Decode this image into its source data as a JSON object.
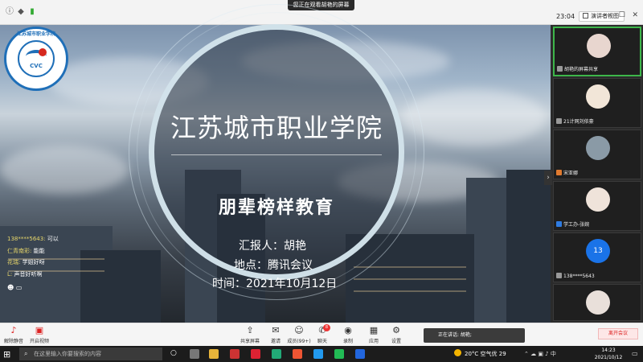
{
  "topbar": {
    "banner": "您正在观看胡艳的屏幕",
    "clock": "23:04",
    "view_mode": "演讲者视图"
  },
  "slide": {
    "school": "江苏城市职业学院",
    "subtitle": "朋辈榜样教育",
    "reporter": "汇报人：胡艳",
    "location": "地点：腾讯会议",
    "time": "时间：2021年10月12日",
    "logo": {
      "ring_text": "江苏城市职业学院",
      "abbr": "CVC"
    }
  },
  "chat": [
    {
      "name": "138****5643:",
      "text": "可以"
    },
    {
      "name": "仁青南彩:",
      "text": "能能"
    },
    {
      "name": "花瑞:",
      "text": "学姐好呀"
    },
    {
      "name": "L:",
      "text": "声音好听啊"
    }
  ],
  "participants": [
    {
      "name": "胡艳的屏幕共享",
      "active": true
    },
    {
      "name": "21计网刘依豪",
      "active": false
    },
    {
      "name": "宋亚娜",
      "active": false
    },
    {
      "name": "学工办-张婉",
      "active": false
    },
    {
      "name": "138****5643",
      "initials": "13",
      "active": false
    },
    {
      "name": "",
      "active": false
    }
  ],
  "toolbar": {
    "mute": "解除静音",
    "video": "开启视频",
    "share": "共享屏幕",
    "invite": "邀请",
    "members": "成员(99+)",
    "chat": "聊天",
    "record": "录制",
    "apps": "应用",
    "settings": "设置",
    "speaking": "正在讲话: 胡艳;",
    "end": "离开会议",
    "chat_badge": "8"
  },
  "taskbar": {
    "search_placeholder": "在这里输入你要搜索的内容",
    "weather": "20°C 空气优 29",
    "tray_ime": "中",
    "time": "14:23",
    "date": "2021/10/12"
  },
  "colors": {
    "ring": "#d7e8f0",
    "active_tile": "#3db64a",
    "logo_blue": "#1f6fb8"
  }
}
